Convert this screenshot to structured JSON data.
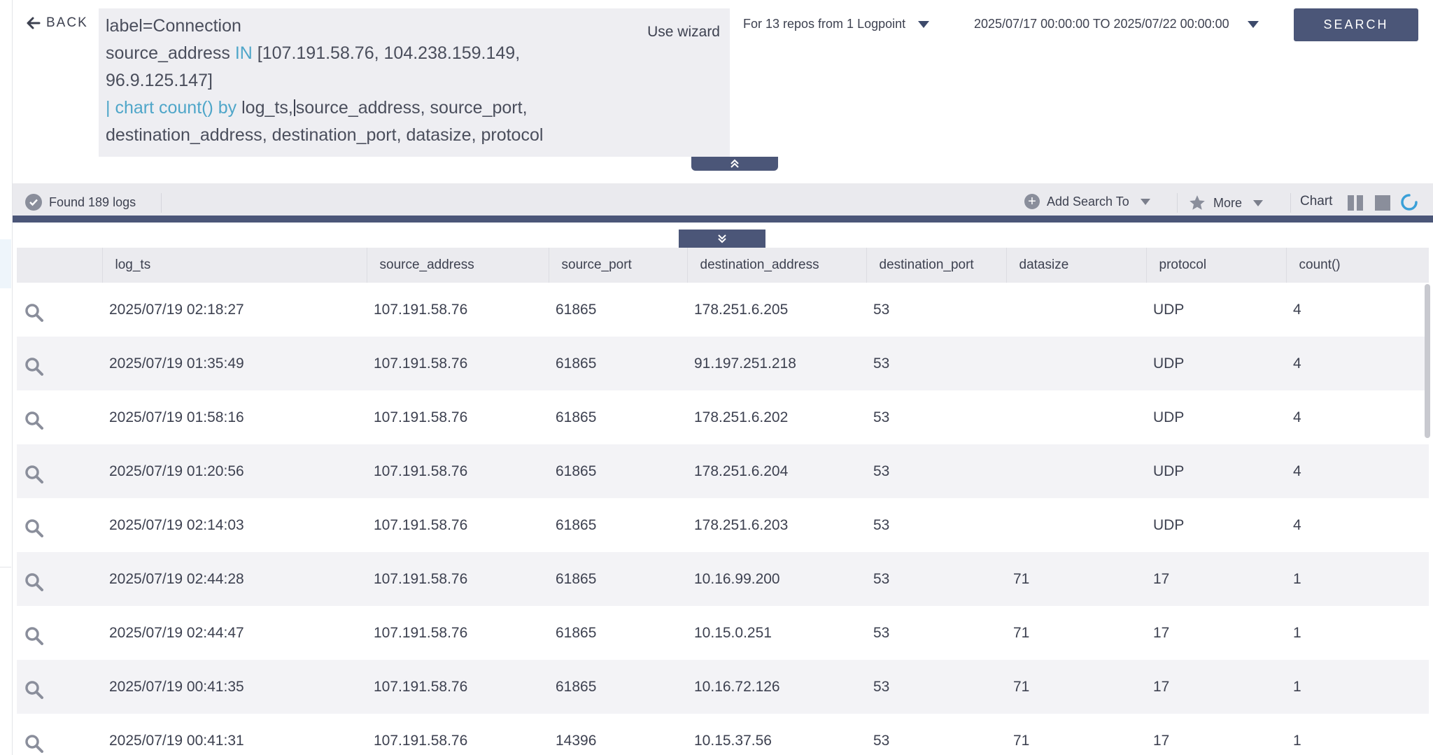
{
  "topbar": {
    "back_label": "BACK",
    "query_lines": {
      "line1": "label=Connection",
      "line2_field": "source_address",
      "line2_op": "IN",
      "line2_values": "[107.191.58.76, 104.238.159.149,",
      "line3": "96.9.125.147]",
      "line4_pipe": "|",
      "line4_cmd": "chart count()",
      "line4_by": "by",
      "line4_before_cursor": "log_ts,",
      "line4_after_cursor": "source_address, source_port,",
      "line5": "destination_address, destination_port, datasize, protocol"
    },
    "use_wizard_label": "Use wizard",
    "repos_label": "For 13 repos from 1 Logpoint",
    "time_range_label": "2025/07/17 00:00:00 TO 2025/07/22 00:00:00",
    "search_label": "SEARCH"
  },
  "toolbar": {
    "found_label": "Found 189 logs",
    "add_search_label": "Add Search To",
    "more_label": "More",
    "chart_label": "Chart"
  },
  "table": {
    "columns": [
      "log_ts",
      "source_address",
      "source_port",
      "destination_address",
      "destination_port",
      "datasize",
      "protocol",
      "count()"
    ],
    "rows": [
      [
        "2025/07/19 02:18:27",
        "107.191.58.76",
        "61865",
        "178.251.6.205",
        "53",
        "",
        "UDP",
        "4"
      ],
      [
        "2025/07/19 01:35:49",
        "107.191.58.76",
        "61865",
        "91.197.251.218",
        "53",
        "",
        "UDP",
        "4"
      ],
      [
        "2025/07/19 01:58:16",
        "107.191.58.76",
        "61865",
        "178.251.6.202",
        "53",
        "",
        "UDP",
        "4"
      ],
      [
        "2025/07/19 01:20:56",
        "107.191.58.76",
        "61865",
        "178.251.6.204",
        "53",
        "",
        "UDP",
        "4"
      ],
      [
        "2025/07/19 02:14:03",
        "107.191.58.76",
        "61865",
        "178.251.6.203",
        "53",
        "",
        "UDP",
        "4"
      ],
      [
        "2025/07/19 02:44:28",
        "107.191.58.76",
        "61865",
        "10.16.99.200",
        "53",
        "71",
        "17",
        "1"
      ],
      [
        "2025/07/19 02:44:47",
        "107.191.58.76",
        "61865",
        "10.15.0.251",
        "53",
        "71",
        "17",
        "1"
      ],
      [
        "2025/07/19 00:41:35",
        "107.191.58.76",
        "61865",
        "10.16.72.126",
        "53",
        "71",
        "17",
        "1"
      ],
      [
        "2025/07/19 00:41:31",
        "107.191.58.76",
        "14396",
        "10.15.37.56",
        "53",
        "71",
        "17",
        "1"
      ]
    ]
  },
  "colors": {
    "accent": "#4b5678",
    "keyword": "#4fa6c9",
    "query_bg": "#eeeef2",
    "toolbar_bg": "#eaeaee"
  },
  "icons": {
    "back": "arrow-left-icon",
    "row_action": "magnifier-icon",
    "found": "check-circle-icon",
    "add_search": "plus-circle-icon",
    "more": "star-icon",
    "refresh": "refresh-icon"
  }
}
